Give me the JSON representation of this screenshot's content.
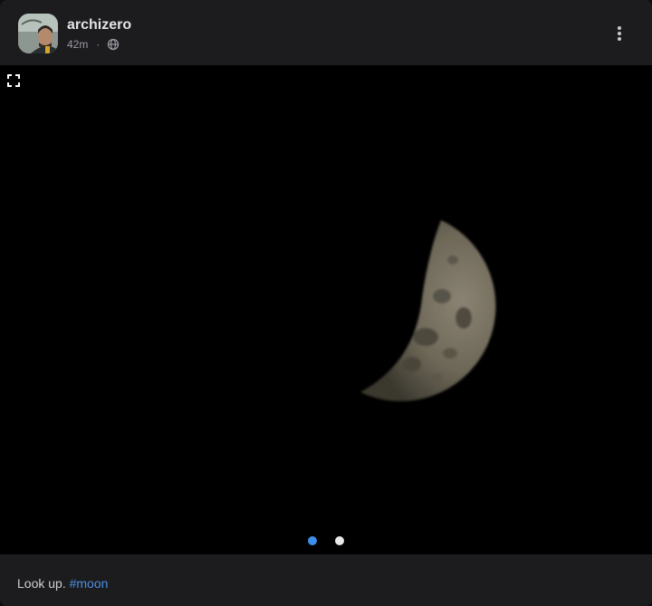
{
  "post": {
    "username": "archizero",
    "time": "42m",
    "separator": "·",
    "visibility_icon": "globe-icon",
    "caption_text": "Look up.",
    "hashtag": "#moon"
  },
  "media": {
    "subject": "moon-photo",
    "expand_icon": "expand-icon",
    "pages": 2,
    "current_page": 1
  },
  "colors": {
    "card_background": "#1c1c1f",
    "media_background": "#000000",
    "pager_active": "#3b8fea",
    "pager_inactive": "#e8e8e8",
    "hashtag": "#4b8fe0"
  },
  "icons": {
    "more": "more-vertical-icon",
    "globe": "globe-icon"
  }
}
